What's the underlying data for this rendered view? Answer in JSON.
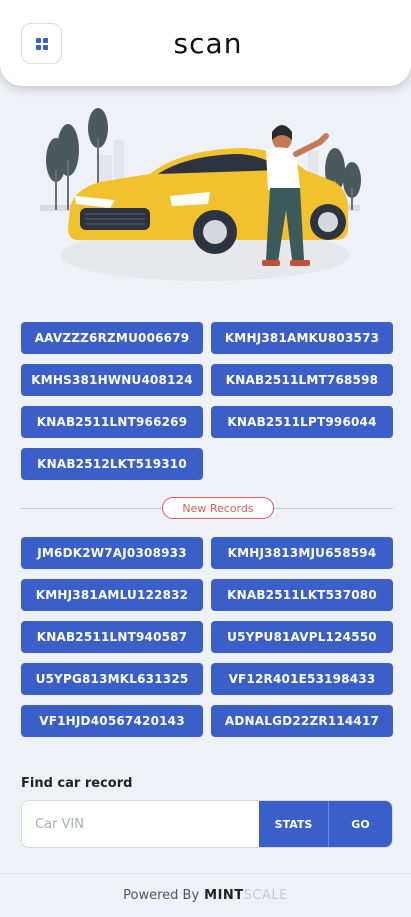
{
  "header": {
    "logo_text": "scan",
    "menu_icon": "grid-icon"
  },
  "vin_records": [
    "AAVZZZ6RZMU006679",
    "KMHJ381AMKU803573",
    "KMHS381HWNU408124",
    "KNAB2511LMT768598",
    "KNAB2511LNT966269",
    "KNAB2511LPT996044",
    "KNAB2512LKT519310"
  ],
  "new_records_label": "New Records",
  "new_records": [
    "JM6DK2W7AJ0308933",
    "KMHJ3813MJU658594",
    "KMHJ381AMLU122832",
    "KNAB2511LKT537080",
    "KNAB2511LNT940587",
    "U5YPU81AVPL124550",
    "U5YPG813MKL631325",
    "VF12R401E53198433",
    "VF1HJD40567420143",
    "ADNALGD22ZR114417"
  ],
  "search": {
    "label": "Find car record",
    "placeholder": "Car VIN",
    "stats_label": "STATS",
    "go_label": "GO"
  },
  "footer": {
    "powered_by": "Powered By",
    "brand_part1": "MINT",
    "brand_part2": "SCALE"
  },
  "colors": {
    "primary": "#3a5fc8",
    "badge": "#e05a5a",
    "background": "#eef1f6"
  }
}
